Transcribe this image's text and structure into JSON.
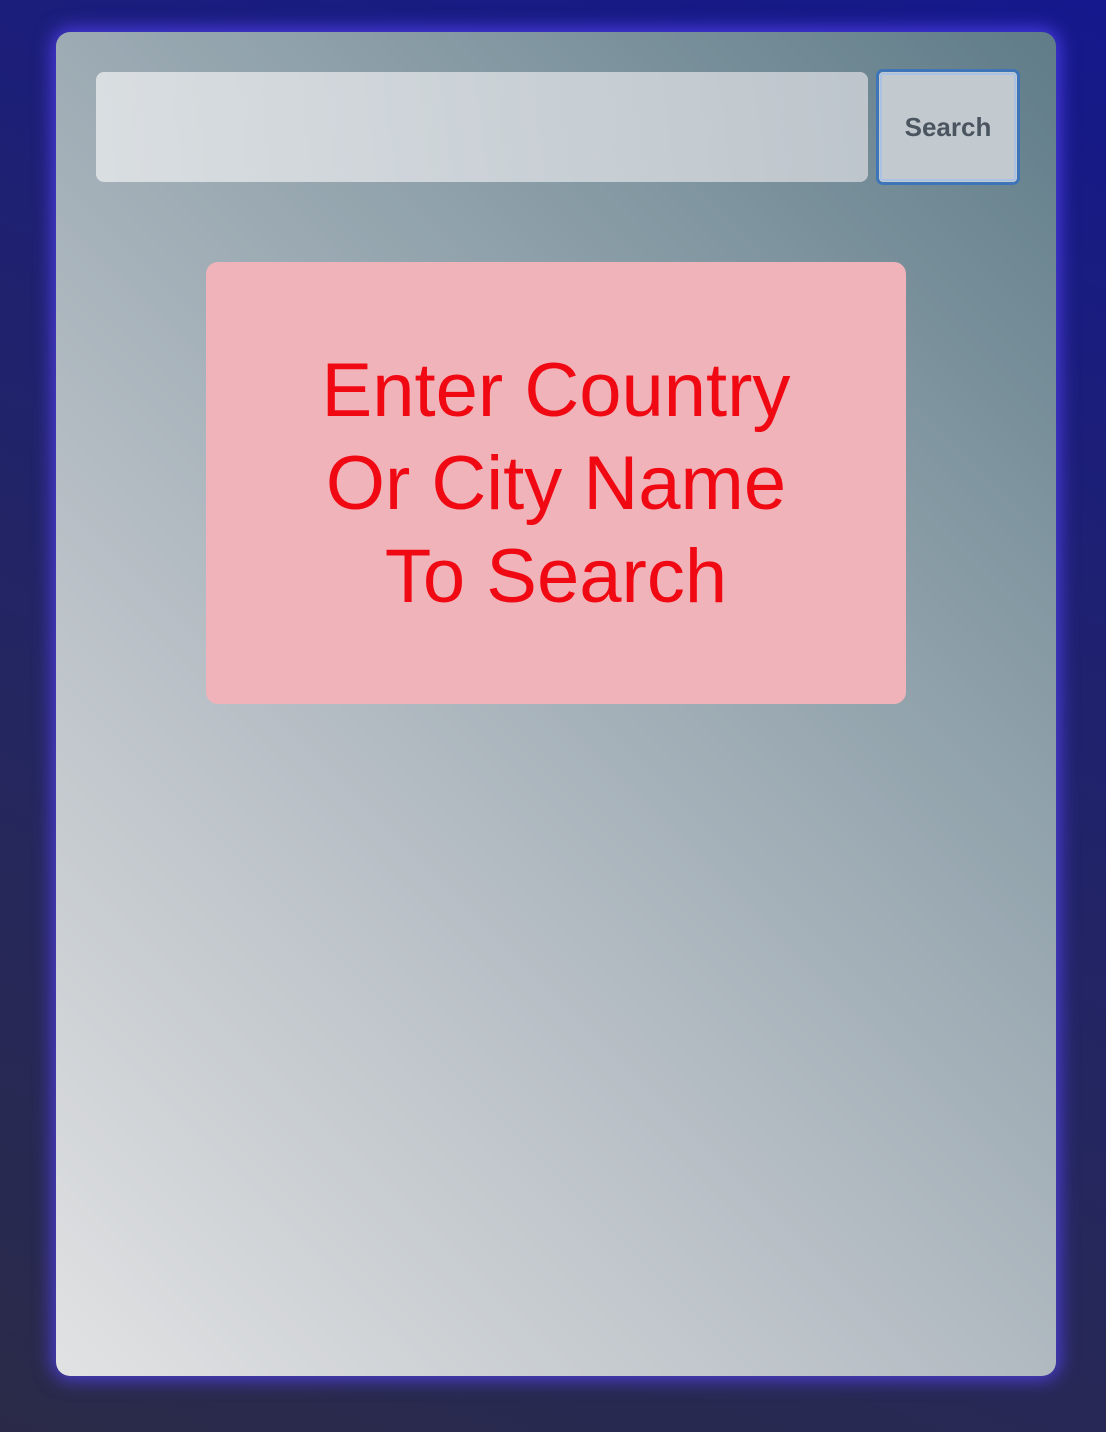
{
  "search": {
    "value": "",
    "placeholder": "",
    "button_label": "Search"
  },
  "message": {
    "text": "Enter Country Or City Name To Search"
  },
  "colors": {
    "page_background": "#1a1c78",
    "card_glow": "#5a46ff",
    "message_background": "#f0b3b9",
    "message_text": "#f00813",
    "button_border": "#3e74b8"
  }
}
